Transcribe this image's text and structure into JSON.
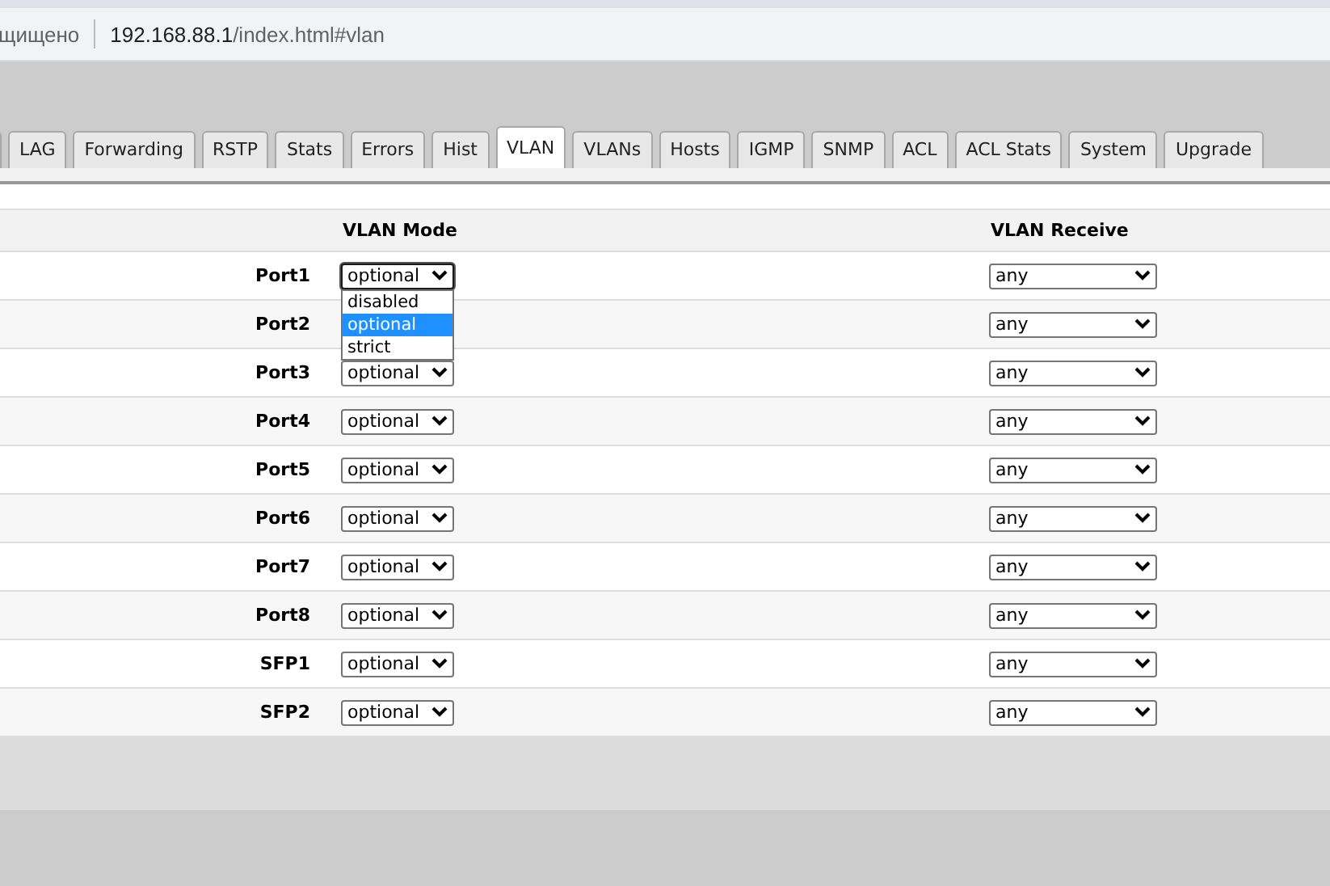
{
  "address_bar": {
    "security_text": "щищено",
    "host": "192.168.88.1",
    "path": "/index.html#vlan"
  },
  "tabs": [
    {
      "label": "LAG",
      "selected": false
    },
    {
      "label": "Forwarding",
      "selected": false
    },
    {
      "label": "RSTP",
      "selected": false
    },
    {
      "label": "Stats",
      "selected": false
    },
    {
      "label": "Errors",
      "selected": false
    },
    {
      "label": "Hist",
      "selected": false
    },
    {
      "label": "VLAN",
      "selected": true
    },
    {
      "label": "VLANs",
      "selected": false
    },
    {
      "label": "Hosts",
      "selected": false
    },
    {
      "label": "IGMP",
      "selected": false
    },
    {
      "label": "SNMP",
      "selected": false
    },
    {
      "label": "ACL",
      "selected": false
    },
    {
      "label": "ACL Stats",
      "selected": false
    },
    {
      "label": "System",
      "selected": false
    },
    {
      "label": "Upgrade",
      "selected": false
    }
  ],
  "table": {
    "columns": [
      "VLAN Mode",
      "VLAN Receive"
    ],
    "rows": [
      {
        "port": "Port1",
        "mode": "optional",
        "receive": "any",
        "expanded": true
      },
      {
        "port": "Port2",
        "receive": "any",
        "expanded": false
      },
      {
        "port": "Port3",
        "mode": "optional",
        "receive": "any",
        "expanded": false
      },
      {
        "port": "Port4",
        "mode": "optional",
        "receive": "any",
        "expanded": false
      },
      {
        "port": "Port5",
        "mode": "optional",
        "receive": "any",
        "expanded": false
      },
      {
        "port": "Port6",
        "mode": "optional",
        "receive": "any",
        "expanded": false
      },
      {
        "port": "Port7",
        "mode": "optional",
        "receive": "any",
        "expanded": false
      },
      {
        "port": "Port8",
        "mode": "optional",
        "receive": "any",
        "expanded": false
      },
      {
        "port": "SFP1",
        "mode": "optional",
        "receive": "any",
        "expanded": false
      },
      {
        "port": "SFP2",
        "mode": "optional",
        "receive": "any",
        "expanded": false
      }
    ]
  },
  "mode_options": [
    {
      "label": "disabled",
      "selected": false
    },
    {
      "label": "optional",
      "selected": true
    },
    {
      "label": "strict",
      "selected": false
    }
  ]
}
